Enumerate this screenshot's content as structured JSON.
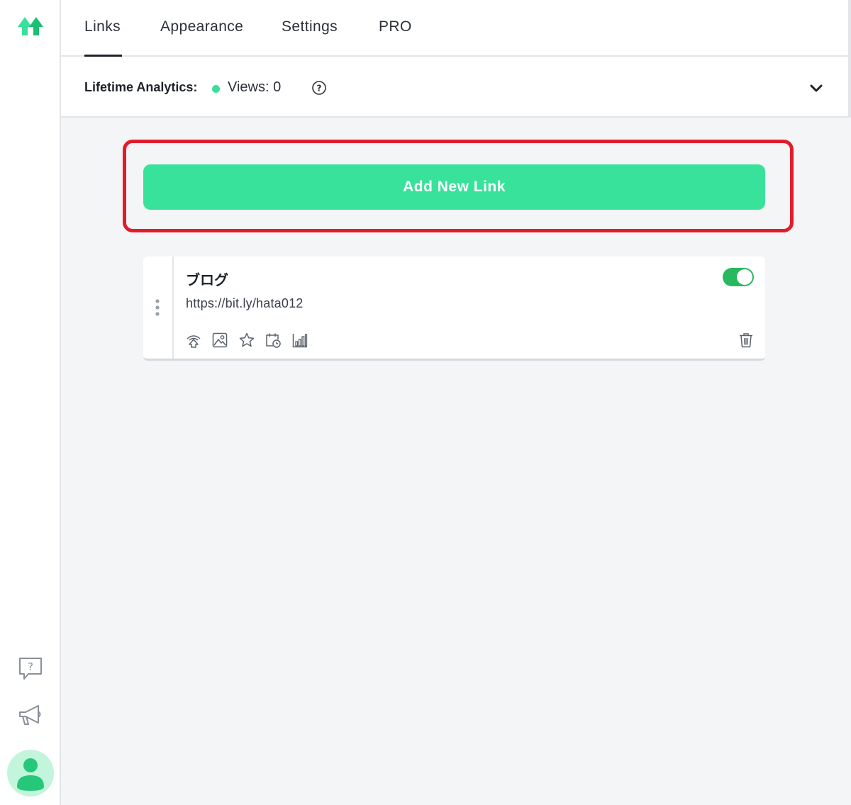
{
  "colors": {
    "accent": "#39e29b",
    "highlight_border": "#e11d2c",
    "toggle_on": "#28b85e",
    "main_bg": "#f4f5f7"
  },
  "sidebar": {
    "logo_icon": "linktree-logo-icon",
    "help_icon": "help-chat-icon",
    "announcements_icon": "megaphone-icon",
    "avatar_icon": "user-avatar-icon"
  },
  "header": {
    "tabs": [
      {
        "label": "Links",
        "active": true
      },
      {
        "label": "Appearance",
        "active": false
      },
      {
        "label": "Settings",
        "active": false
      },
      {
        "label": "PRO",
        "active": false
      }
    ]
  },
  "analytics": {
    "label": "Lifetime Analytics:",
    "views": "Views: 0",
    "status_color": "#39e09b"
  },
  "main": {
    "add_link_label": "Add New Link",
    "links": [
      {
        "title": "ブログ",
        "url": "https://bit.ly/hata012",
        "enabled": true,
        "tools": [
          "animation-icon",
          "thumbnail-icon",
          "priority-star-icon",
          "schedule-icon",
          "analytics-chart-icon"
        ],
        "delete_icon": "trash-icon"
      }
    ]
  }
}
